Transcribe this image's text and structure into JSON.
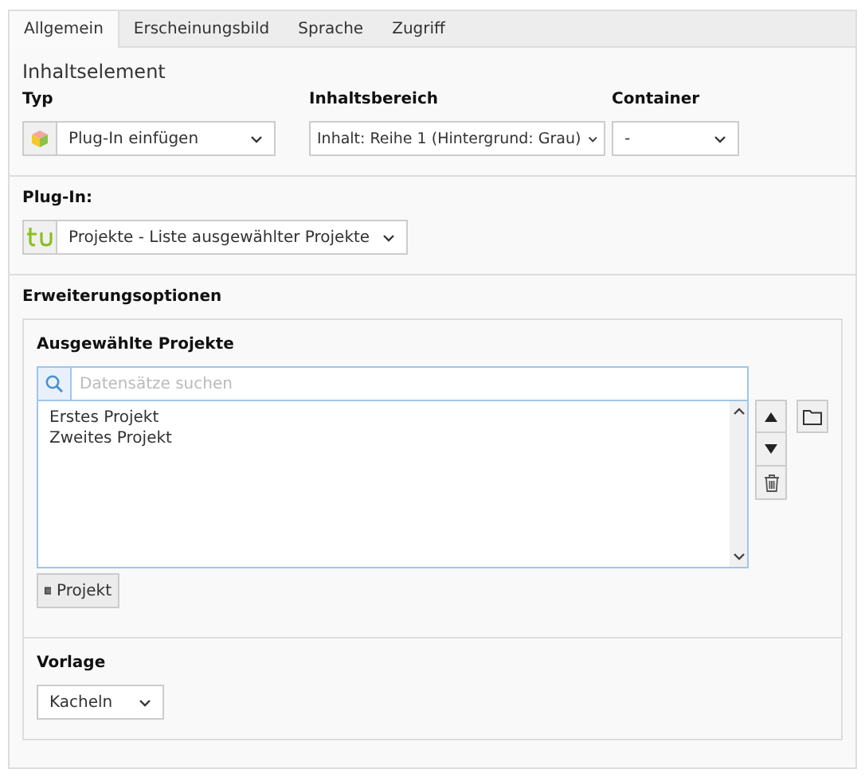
{
  "tabs": [
    {
      "label": "Allgemein",
      "selected": true
    },
    {
      "label": "Erscheinungsbild",
      "selected": false
    },
    {
      "label": "Sprache",
      "selected": false
    },
    {
      "label": "Zugriff",
      "selected": false
    }
  ],
  "general": {
    "heading": "Inhaltselement",
    "fields": [
      {
        "label": "Typ",
        "value": "Plug-In einfügen",
        "kind": "cube"
      },
      {
        "label": "Inhaltsbereich",
        "value": "Inhalt: Reihe 1 (Hintergrund: Grau)",
        "kind": "plain"
      },
      {
        "label": "Container",
        "value": "-",
        "kind": "plain"
      }
    ]
  },
  "plugin": {
    "label": "Plug-In:",
    "value": "Projekte - Liste ausgewählter Projekte"
  },
  "extension": {
    "heading": "Erweiterungsoptionen",
    "group_label": "Ausgewählte Projekte",
    "search": {
      "placeholder": "Datensätze suchen"
    },
    "items": [
      "Erstes Projekt",
      "Zweites Projekt"
    ],
    "add_button": "Projekt",
    "template": {
      "label": "Vorlage",
      "value": "Kacheln"
    }
  }
}
